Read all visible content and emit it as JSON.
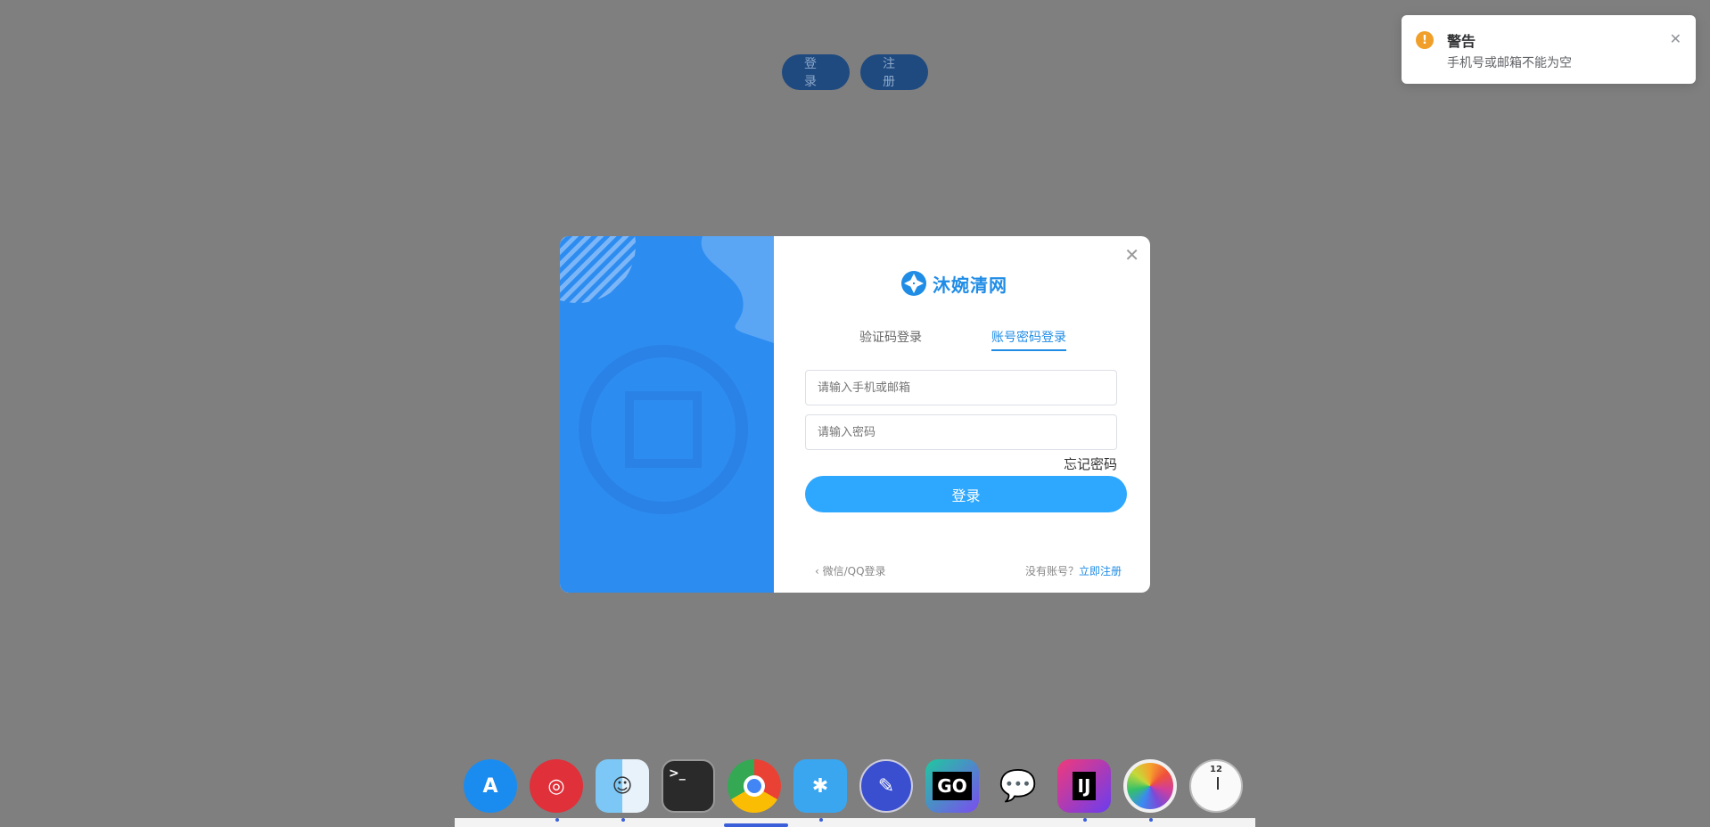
{
  "top_buttons": {
    "login": "登录",
    "register": "注册"
  },
  "toast": {
    "title": "警告",
    "message": "手机号或邮箱不能为空",
    "icon": "warning-icon",
    "color": "#f0a02a"
  },
  "modal": {
    "logo_text": "沐婉清网",
    "tabs": [
      {
        "label": "验证码登录"
      },
      {
        "label": "账号密码登录",
        "active": true
      }
    ],
    "fields": {
      "account_placeholder": "请输入手机或邮箱",
      "password_placeholder": "请输入密码"
    },
    "forgot": "忘记密码",
    "submit": "登录",
    "alt_login": "微信/QQ登录",
    "no_account": "没有账号？",
    "register_link": "立即注册",
    "accent": "#1f8ce6",
    "panel_color": "#2d8cf0"
  },
  "dock": {
    "apps": [
      {
        "name": "app-store-icon"
      },
      {
        "name": "netease-music-icon"
      },
      {
        "name": "finder-icon"
      },
      {
        "name": "terminal-icon"
      },
      {
        "name": "chrome-icon"
      },
      {
        "name": "tool-star-icon"
      },
      {
        "name": "postman-icon"
      },
      {
        "name": "goland-icon",
        "label": "GO"
      },
      {
        "name": "wechat-icon"
      },
      {
        "name": "intellij-icon",
        "label": "IJ"
      },
      {
        "name": "photos-icon"
      },
      {
        "name": "clock-icon",
        "label": "12"
      }
    ]
  }
}
